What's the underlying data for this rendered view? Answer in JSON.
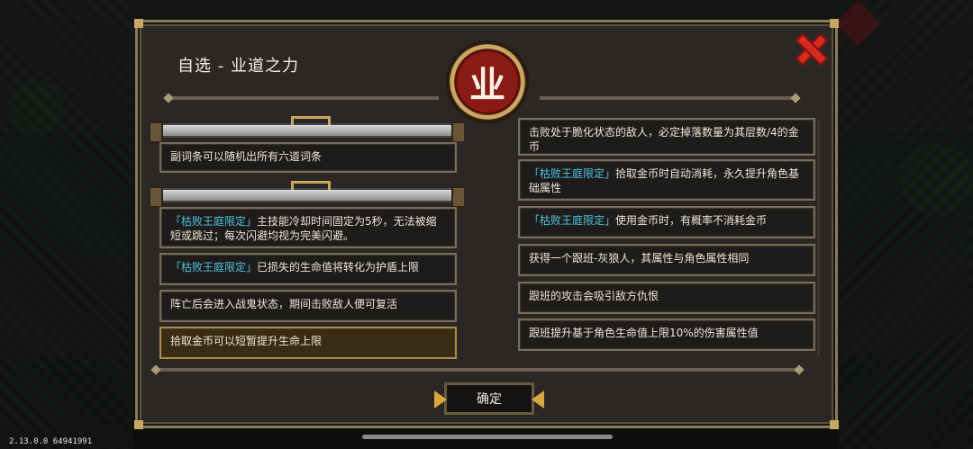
{
  "dialog": {
    "title": "自选 - 业道之力",
    "emblem_glyph": "业",
    "confirm_label": "确定",
    "close_icon": "close-icon"
  },
  "left_options": [
    {
      "tag": "",
      "text": "副词条可以随机出所有六道词条"
    },
    {
      "tag": "「枯败王庭限定」",
      "text": "主技能冷却时间固定为5秒，无法被缩短或跳过；每次闪避均视为完美闪避。"
    },
    {
      "tag": "「枯败王庭限定」",
      "text": "已损失的生命值将转化为护盾上限"
    },
    {
      "tag": "",
      "text": "阵亡后会进入战鬼状态，期间击败敌人便可复活"
    },
    {
      "tag": "",
      "text": "拾取金币可以短暂提升生命上限",
      "selected": true
    }
  ],
  "right_options": [
    {
      "tag": "",
      "text": "击败处于脆化状态的敌人，必定掉落数量为其层数/4的金币"
    },
    {
      "tag": "「枯败王庭限定」",
      "text": "拾取金币时自动消耗，永久提升角色基础属性"
    },
    {
      "tag": "「枯败王庭限定」",
      "text": "使用金币时，有概率不消耗金币"
    },
    {
      "tag": "",
      "text": "获得一个跟班-灰狼人，其属性与角色属性相同"
    },
    {
      "tag": "",
      "text": "跟班的攻击会吸引敌方仇恨"
    },
    {
      "tag": "",
      "text": "跟班提升基于角色生命值上限10%的伤害属性值"
    }
  ],
  "footer": {
    "version": "2.13.0.0 64941991"
  },
  "colors": {
    "tag": "#4fc3e0",
    "close": "#d92a1f",
    "accent_gold": "#c9a661"
  }
}
